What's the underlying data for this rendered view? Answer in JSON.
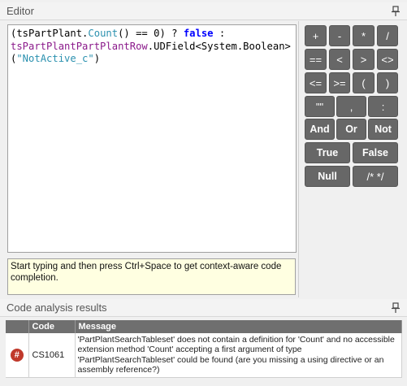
{
  "editor": {
    "title": "Editor",
    "code_line1_a": "(tsPartPlant.",
    "code_line1_b": "Count",
    "code_line1_c": "() == ",
    "code_line1_d": "0",
    "code_line1_e": ") ? ",
    "code_line1_f": "false",
    "code_line1_g": " :",
    "code_line2_a": "tsPartPlantPartPlantRow",
    "code_line2_b": ".UDField<System.Boolean>",
    "code_line3_a": "(",
    "code_line3_b": "\"NotActive_c\"",
    "code_line3_c": ")",
    "hint": "Start typing and then press Ctrl+Space to get context-aware code completion."
  },
  "keypad": {
    "plus": "+",
    "minus": "-",
    "multiply": "*",
    "divide": "/",
    "equals": "==",
    "less": "<",
    "greater": ">",
    "not_equal": "<>",
    "less_equal": "<=",
    "greater_equal": ">=",
    "open_paren": "(",
    "close_paren": ")",
    "quotes": "\"\"",
    "comma": ",",
    "colon": ":",
    "and": "And",
    "or": "Or",
    "not": "Not",
    "true": "True",
    "false": "False",
    "null": "Null",
    "comment": "/* */"
  },
  "analysis": {
    "title": "Code analysis results",
    "columns": [
      "",
      "Code",
      "Message"
    ],
    "rows": [
      {
        "code": "CS1061",
        "message": "'PartPlantSearchTableset' does not contain a definition for 'Count' and no accessible extension method 'Count' accepting a first argument of type 'PartPlantSearchTableset' could be found (are you missing a using directive or an assembly reference?)"
      }
    ]
  }
}
